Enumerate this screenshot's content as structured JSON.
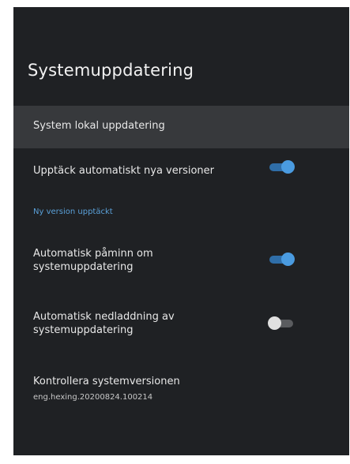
{
  "header": {
    "title": "Systemuppdatering"
  },
  "settings": {
    "local_update_label": "System lokal uppdatering",
    "auto_detect_label": "Upptäck automatiskt nya versioner",
    "auto_detect_on": true,
    "new_version_notice": "Ny version upptäckt",
    "auto_reminder_label": "Automatisk påminn om systemuppdatering",
    "auto_reminder_on": true,
    "auto_download_label": "Automatisk nedladdning av systemuppdatering",
    "auto_download_on": false,
    "check_version_label": "Kontrollera systemversionen",
    "version_value": "eng.hexing.20200824.100214"
  },
  "colors": {
    "background": "#1f2124",
    "highlight": "#37393c",
    "toggle_on": "#4a9be0",
    "toggle_off": "#e0e0e0",
    "link": "#5aa0d8"
  }
}
